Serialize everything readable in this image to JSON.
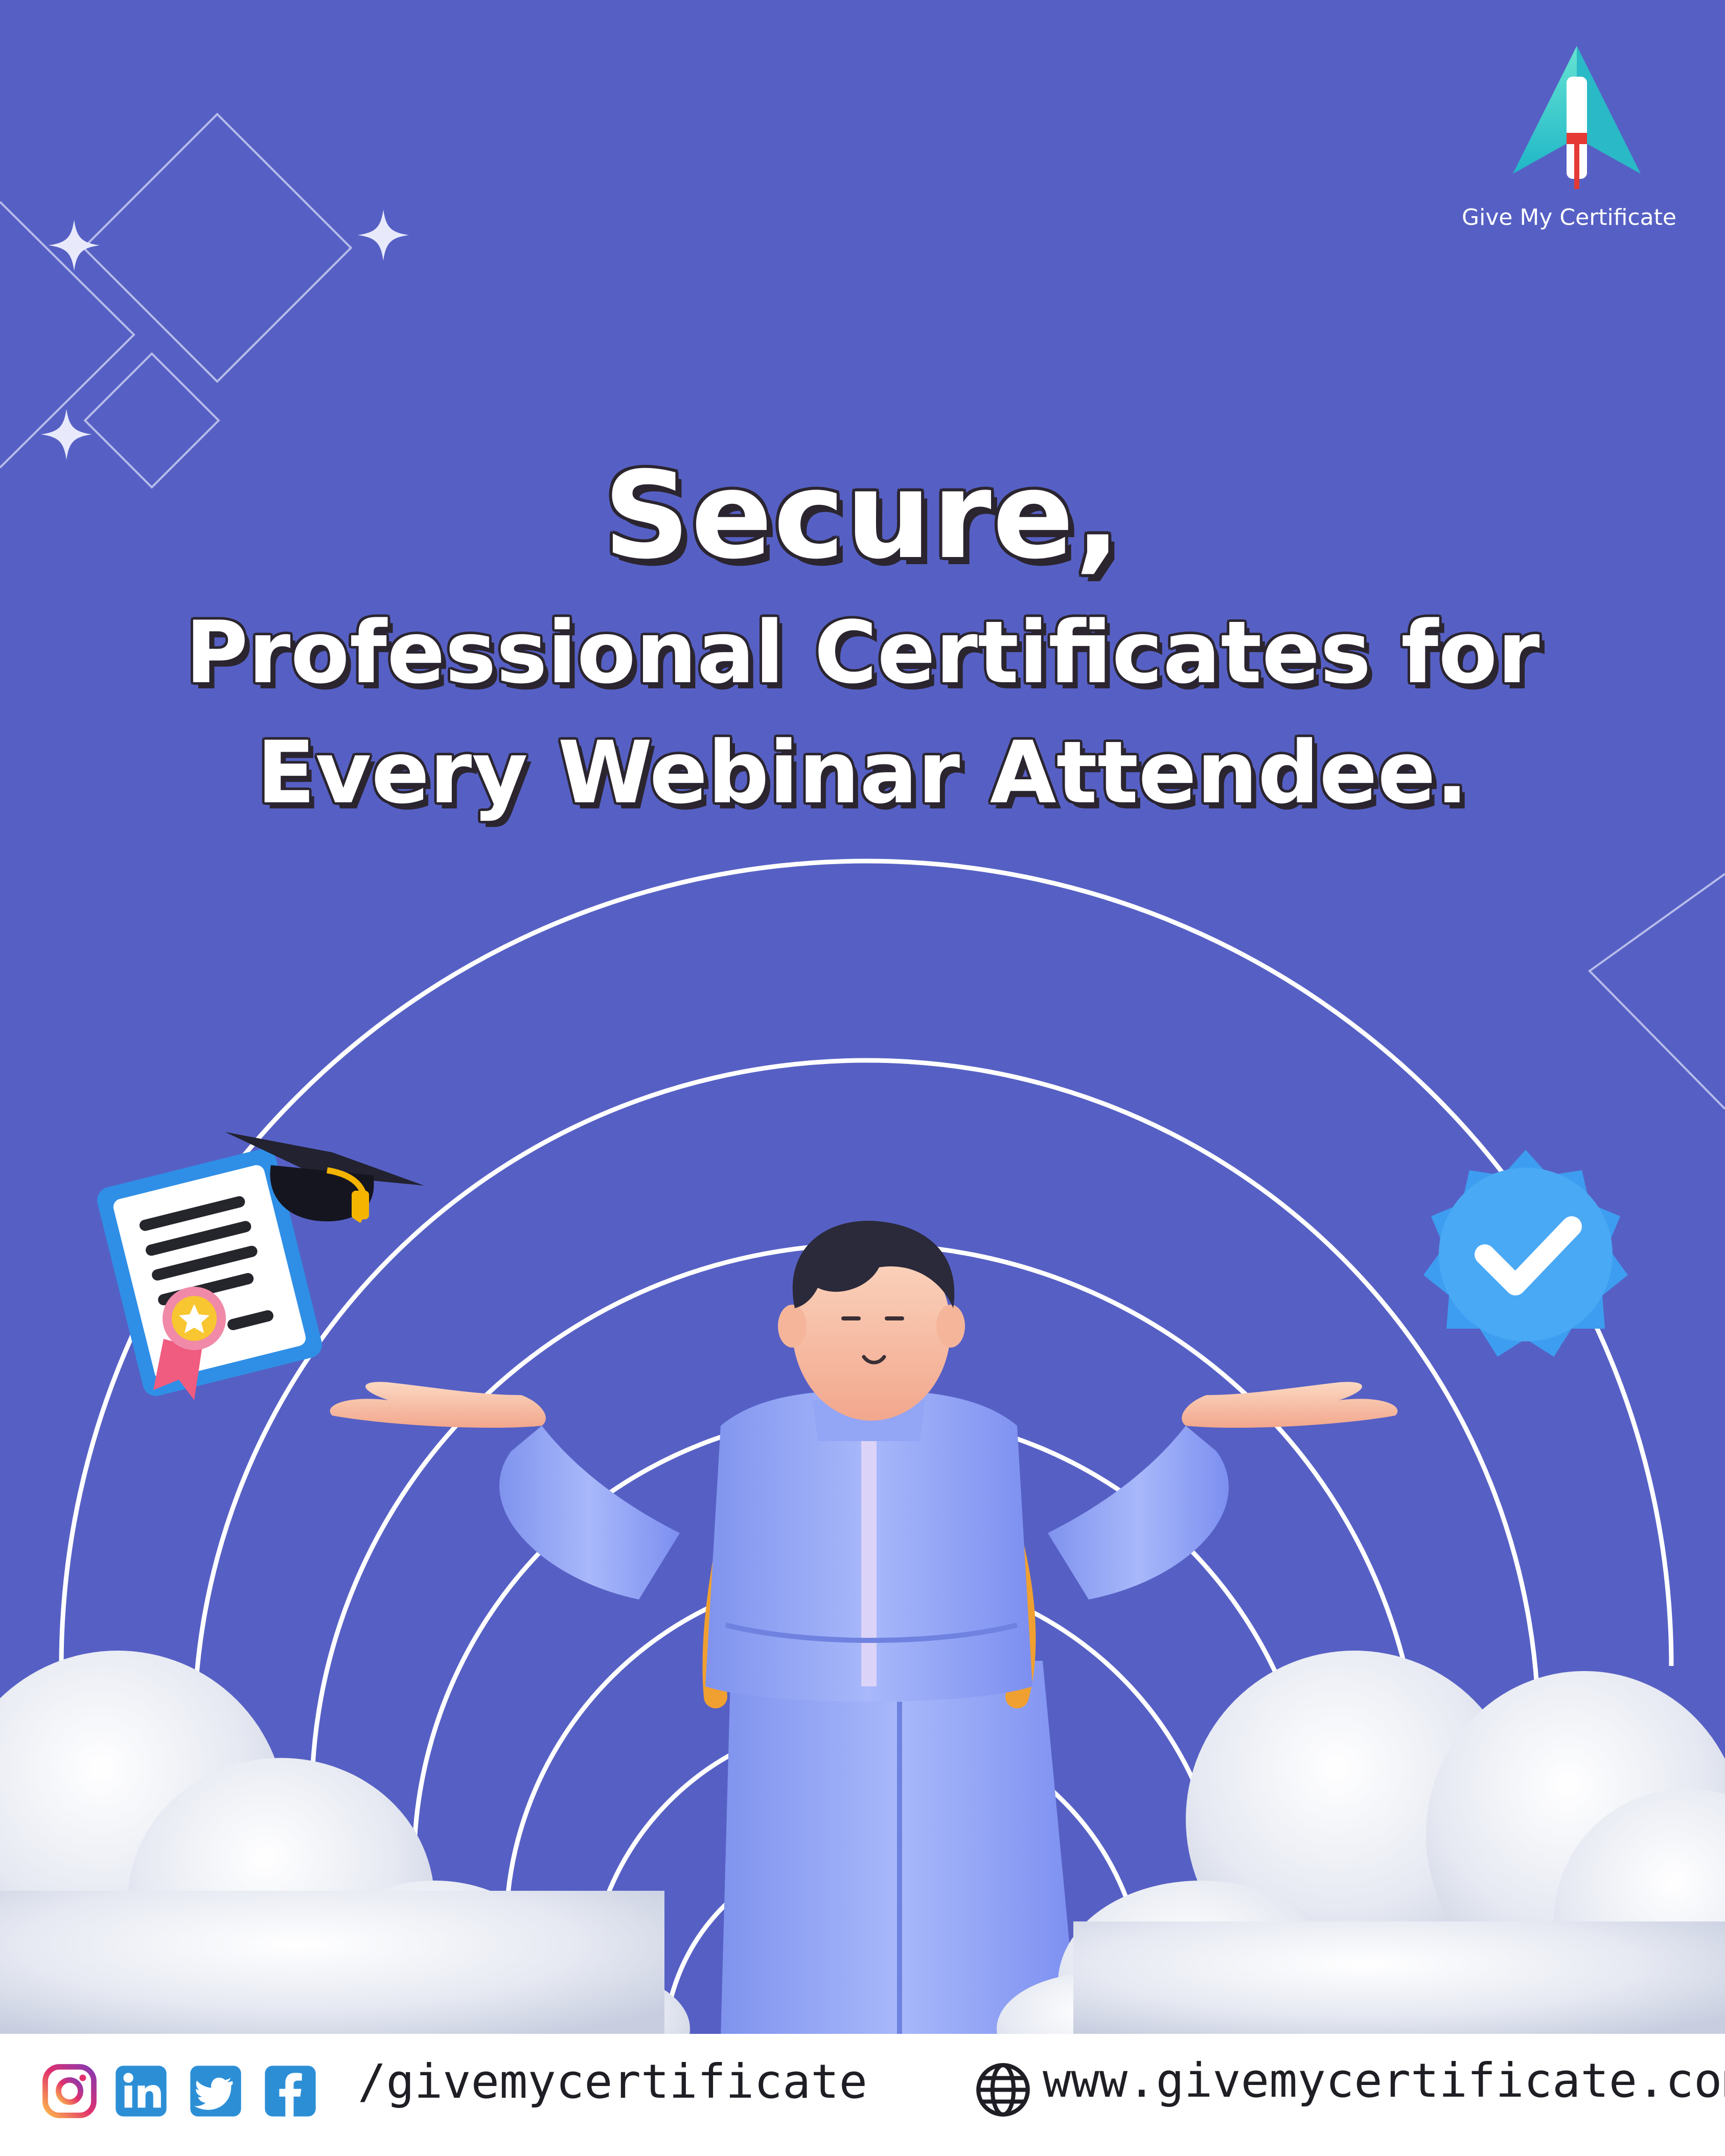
{
  "brand": {
    "name": "Give My Certificate",
    "logo_icon": "paper-plane-certificate-icon"
  },
  "headline": {
    "line1": "Secure,",
    "line2": "Professional Certificates for",
    "line3": "Every Webinar Attendee."
  },
  "illustrations": {
    "character": "student-with-backpack-figure",
    "certificate": "certificate-with-ribbon-icon",
    "cap": "graduation-cap-icon",
    "badge": "verified-check-badge-icon"
  },
  "footer": {
    "social_icons": [
      "instagram-icon",
      "linkedin-icon",
      "twitter-icon",
      "facebook-icon"
    ],
    "handle": "/givemycertificate",
    "website_icon": "globe-icon",
    "website": "www.givemycertificate.com"
  },
  "colors": {
    "background": "#5660c4",
    "text": "#ffffff",
    "text_outline": "#2b2530",
    "footer_bg": "#ffffff",
    "badge_blue": "#3d9df0",
    "suit_blue": "#8da1f2",
    "strap_orange": "#f2a232",
    "cloud": "#e9ecf4"
  }
}
